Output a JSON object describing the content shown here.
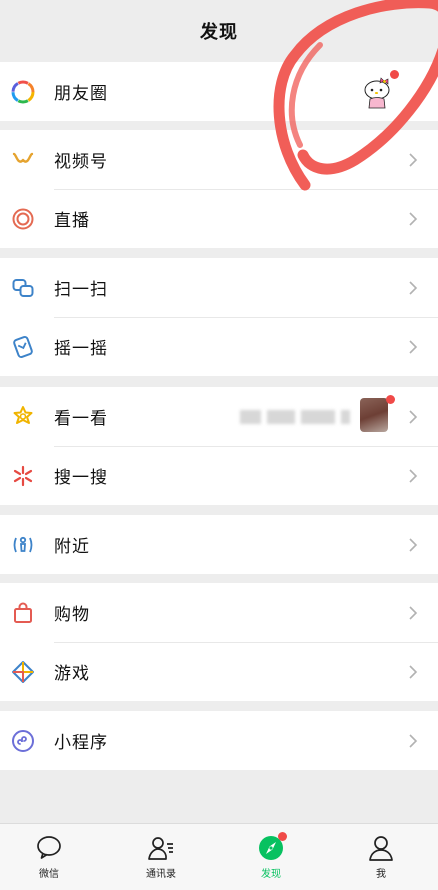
{
  "header": {
    "title": "发现"
  },
  "groups": [
    {
      "items": [
        {
          "label": "朋友圈",
          "icon": "moments-icon"
        }
      ]
    },
    {
      "items": [
        {
          "label": "视频号",
          "icon": "channels-icon"
        },
        {
          "label": "直播",
          "icon": "live-icon"
        }
      ]
    },
    {
      "items": [
        {
          "label": "扫一扫",
          "icon": "scan-icon"
        },
        {
          "label": "摇一摇",
          "icon": "shake-icon"
        }
      ]
    },
    {
      "items": [
        {
          "label": "看一看",
          "icon": "top-stories-icon"
        },
        {
          "label": "搜一搜",
          "icon": "search-icon"
        }
      ]
    },
    {
      "items": [
        {
          "label": "附近",
          "icon": "nearby-icon"
        }
      ]
    },
    {
      "items": [
        {
          "label": "购物",
          "icon": "shopping-bag-icon"
        },
        {
          "label": "游戏",
          "icon": "games-icon"
        }
      ]
    },
    {
      "items": [
        {
          "label": "小程序",
          "icon": "mini-programs-icon"
        }
      ]
    }
  ],
  "tabbar": {
    "tabs": [
      {
        "label": "微信",
        "icon": "chat-bubble-icon"
      },
      {
        "label": "通讯录",
        "icon": "contacts-icon"
      },
      {
        "label": "发现",
        "icon": "compass-icon",
        "active": true
      },
      {
        "label": "我",
        "icon": "profile-icon"
      }
    ]
  },
  "colors": {
    "accent": "#07c160",
    "badge": "#f04a48",
    "background": "#ededed",
    "annotation": "#f0504a"
  }
}
